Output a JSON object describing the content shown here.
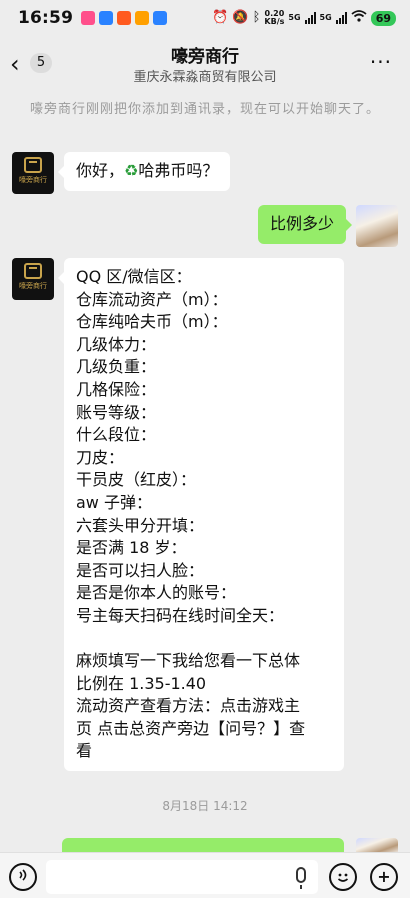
{
  "status_bar": {
    "time": "16:59",
    "network_speed_value": "0.20",
    "network_speed_unit": "KB/s",
    "sim1": "5G",
    "sim2": "5G",
    "battery": "69",
    "notif_colors": [
      "#ff4f8b",
      "#2a82ff",
      "#ff5a1f",
      "#ffa000",
      "#2a82ff"
    ]
  },
  "header": {
    "back_badge": "5",
    "title": "嚎旁商行",
    "subtitle": "重庆永霖淼商贸有限公司",
    "more_icon": "more-icon"
  },
  "system_notice": "嚎旁商行刚刚把你添加到通讯录，现在可以开始聊天了。",
  "messages": {
    "m1": {
      "prefix": "你好，",
      "emoji": "♻",
      "suffix": "哈弗币吗？"
    },
    "m2": {
      "text": "比例多少"
    },
    "m3": {
      "lines": [
        "QQ 区/微信区：",
        "仓库流动资产（m）：",
        "仓库纯哈夫币（m）：",
        "几级体力：",
        "几级负重：",
        "几格保险：",
        "账号等级：",
        "什么段位：",
        "刀皮：",
        "干员皮（红皮）：",
        "aw 子弹：",
        "六套头甲分开填：",
        "是否满 18 岁：",
        "是否可以扫人脸：",
        "是否是你本人的账号：",
        "号主每天扫码在线时间全天：",
        "",
        "麻烦填写一下我给您看一下总体",
        "比例在 1.35-1.40",
        "流动资产查看方法：点击游戏主",
        "页 点击总资产旁边【问号？】查",
        "看"
      ]
    }
  },
  "avatar_company_text": "嚎旁商行",
  "timestamp": "8月18日 14:12",
  "colors": {
    "bubble_green": "#95ec69",
    "background": "#ededed"
  }
}
